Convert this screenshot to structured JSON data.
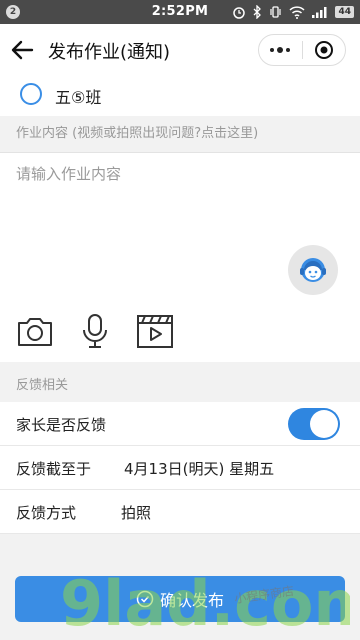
{
  "status_bar": {
    "notification_count": "2",
    "time": "2:52PM",
    "battery": "44"
  },
  "nav": {
    "title": "发布作业(通知)"
  },
  "class_option": {
    "label": "五⑤班"
  },
  "homework": {
    "section_label_prefix": "作业内容 ",
    "section_link": "(视频或拍照出现问题?点击这里)",
    "placeholder": "请输入作业内容"
  },
  "feedback": {
    "section_label": "反馈相关",
    "parent_feedback_label": "家长是否反馈",
    "parent_feedback_on": true,
    "deadline_label": "反馈截至于",
    "deadline_value": "4月13日(明天) 星期五",
    "method_label": "反馈方式",
    "method_value": "拍照"
  },
  "confirm_button": {
    "label": "确认发布"
  },
  "watermark": {
    "main": "9lad.com",
    "tag": "小程序商店"
  },
  "colors": {
    "accent": "#3a8de4",
    "status_bar": "#4a4a4a",
    "page_bg": "#f2f2f2"
  }
}
